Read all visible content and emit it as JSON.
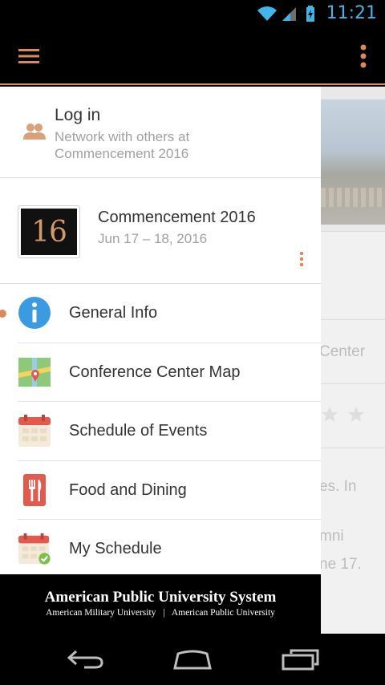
{
  "status_bar": {
    "time": "11:21"
  },
  "app_bar": {
    "menu_icon": "hamburger-icon",
    "overflow_icon": "overflow-dots-icon",
    "accent": "#d9895a"
  },
  "background": {
    "line1": "Center",
    "line2": "es. In",
    "line3": "mni",
    "line4": "ne 17."
  },
  "drawer": {
    "login": {
      "title": "Log in",
      "subtitle": "Network with others at Commencement 2016",
      "icon": "people-icon"
    },
    "event": {
      "logo_text": "16",
      "title": "Commencement 2016",
      "dates": "Jun 17 – 18, 2016"
    },
    "items": [
      {
        "label": "General Info",
        "icon": "info-icon",
        "active": true
      },
      {
        "label": "Conference Center Map",
        "icon": "map-icon",
        "active": false
      },
      {
        "label": "Schedule of Events",
        "icon": "calendar-icon",
        "active": false
      },
      {
        "label": "Food and Dining",
        "icon": "food-icon",
        "active": false
      },
      {
        "label": "My Schedule",
        "icon": "calendar-check-icon",
        "active": false
      }
    ],
    "footer": {
      "title": "American Public University System",
      "sub_left": "American Military University",
      "separator": "|",
      "sub_right": "American Public University"
    }
  },
  "system_nav": {
    "back_icon": "back-icon",
    "home_icon": "home-icon",
    "recents_icon": "recents-icon"
  }
}
